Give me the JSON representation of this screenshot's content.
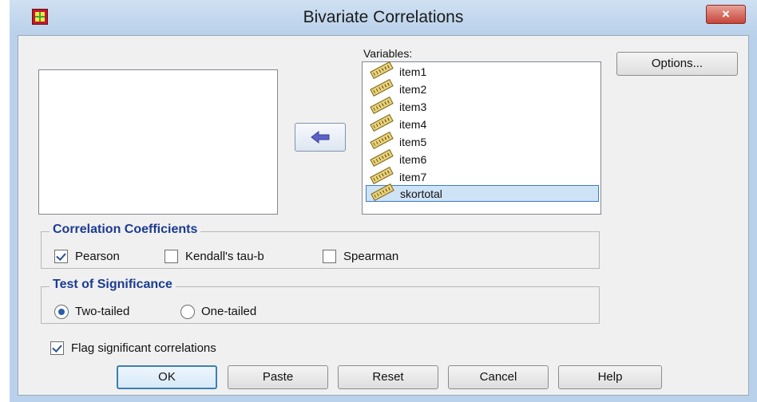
{
  "window": {
    "title": "Bivariate Correlations",
    "close_glyph": "×"
  },
  "variables_label": "Variables:",
  "variables": [
    {
      "name": "item1"
    },
    {
      "name": "item2"
    },
    {
      "name": "item3"
    },
    {
      "name": "item4"
    },
    {
      "name": "item5"
    },
    {
      "name": "item6"
    },
    {
      "name": "item7"
    },
    {
      "name": "skortotal",
      "selected": true
    }
  ],
  "options_button": "Options...",
  "correlation": {
    "title": "Correlation Coefficients",
    "pearson": {
      "label": "Pearson",
      "checked": true
    },
    "kendall": {
      "label": "Kendall's tau-b",
      "checked": false
    },
    "spearman": {
      "label": "Spearman",
      "checked": false
    }
  },
  "significance": {
    "title": "Test of Significance",
    "two_tailed": {
      "label": "Two-tailed",
      "selected": true
    },
    "one_tailed": {
      "label": "One-tailed",
      "selected": false
    }
  },
  "flag": {
    "label": "Flag significant correlations",
    "checked": true
  },
  "buttons": {
    "ok": "OK",
    "paste": "Paste",
    "reset": "Reset",
    "cancel": "Cancel",
    "help": "Help"
  },
  "colors": {
    "accent": "#3c7fb1",
    "group_title": "#1b3b90",
    "selection": "#cfe3f7"
  }
}
